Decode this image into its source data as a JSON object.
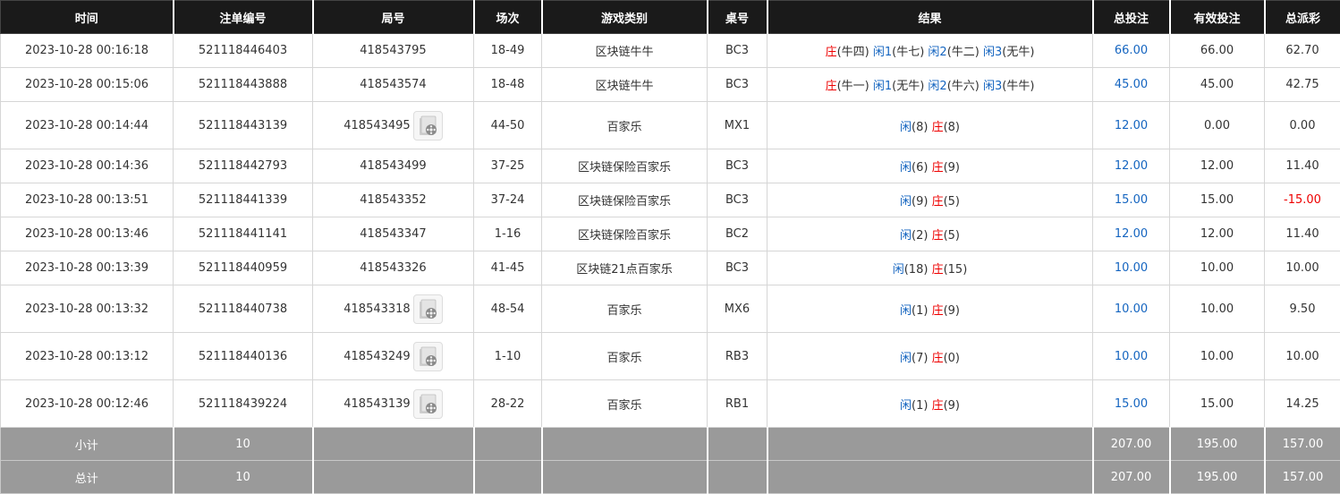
{
  "headers": [
    "时间",
    "注单编号",
    "局号",
    "场次",
    "游戏类别",
    "桌号",
    "结果",
    "总投注",
    "有效投注",
    "总派彩"
  ],
  "rows": [
    {
      "time": "2023-10-28 00:16:18",
      "order": "521118446403",
      "round": "418543795",
      "video": false,
      "game_no": "18-49",
      "type": "区块链牛牛",
      "table": "BC3",
      "result": [
        {
          "t": "庄",
          "c": "red"
        },
        {
          "t": "(牛四) ",
          "c": ""
        },
        {
          "t": "闲1",
          "c": "blue"
        },
        {
          "t": "(牛七) ",
          "c": ""
        },
        {
          "t": "闲2",
          "c": "blue"
        },
        {
          "t": "(牛二) ",
          "c": ""
        },
        {
          "t": "闲3",
          "c": "blue"
        },
        {
          "t": "(无牛)",
          "c": ""
        }
      ],
      "total": "66.00",
      "valid": "66.00",
      "payout": "62.70",
      "payout_neg": false
    },
    {
      "time": "2023-10-28 00:15:06",
      "order": "521118443888",
      "round": "418543574",
      "video": false,
      "game_no": "18-48",
      "type": "区块链牛牛",
      "table": "BC3",
      "result": [
        {
          "t": "庄",
          "c": "red"
        },
        {
          "t": "(牛一) ",
          "c": ""
        },
        {
          "t": "闲1",
          "c": "blue"
        },
        {
          "t": "(无牛) ",
          "c": ""
        },
        {
          "t": "闲2",
          "c": "blue"
        },
        {
          "t": "(牛六) ",
          "c": ""
        },
        {
          "t": "闲3",
          "c": "blue"
        },
        {
          "t": "(牛牛)",
          "c": ""
        }
      ],
      "total": "45.00",
      "valid": "45.00",
      "payout": "42.75",
      "payout_neg": false
    },
    {
      "time": "2023-10-28 00:14:44",
      "order": "521118443139",
      "round": "418543495",
      "video": true,
      "game_no": "44-50",
      "type": "百家乐",
      "table": "MX1",
      "result": [
        {
          "t": "闲",
          "c": "blue"
        },
        {
          "t": "(8) ",
          "c": ""
        },
        {
          "t": "庄",
          "c": "red"
        },
        {
          "t": "(8)",
          "c": ""
        }
      ],
      "total": "12.00",
      "valid": "0.00",
      "payout": "0.00",
      "payout_neg": false
    },
    {
      "time": "2023-10-28 00:14:36",
      "order": "521118442793",
      "round": "418543499",
      "video": false,
      "game_no": "37-25",
      "type": "区块链保险百家乐",
      "table": "BC3",
      "result": [
        {
          "t": "闲",
          "c": "blue"
        },
        {
          "t": "(6) ",
          "c": ""
        },
        {
          "t": "庄",
          "c": "red"
        },
        {
          "t": "(9)",
          "c": ""
        }
      ],
      "total": "12.00",
      "valid": "12.00",
      "payout": "11.40",
      "payout_neg": false
    },
    {
      "time": "2023-10-28 00:13:51",
      "order": "521118441339",
      "round": "418543352",
      "video": false,
      "game_no": "37-24",
      "type": "区块链保险百家乐",
      "table": "BC3",
      "result": [
        {
          "t": "闲",
          "c": "blue"
        },
        {
          "t": "(9) ",
          "c": ""
        },
        {
          "t": "庄",
          "c": "red"
        },
        {
          "t": "(5)",
          "c": ""
        }
      ],
      "total": "15.00",
      "valid": "15.00",
      "payout": "-15.00",
      "payout_neg": true
    },
    {
      "time": "2023-10-28 00:13:46",
      "order": "521118441141",
      "round": "418543347",
      "video": false,
      "game_no": "1-16",
      "type": "区块链保险百家乐",
      "table": "BC2",
      "result": [
        {
          "t": "闲",
          "c": "blue"
        },
        {
          "t": "(2) ",
          "c": ""
        },
        {
          "t": "庄",
          "c": "red"
        },
        {
          "t": "(5)",
          "c": ""
        }
      ],
      "total": "12.00",
      "valid": "12.00",
      "payout": "11.40",
      "payout_neg": false
    },
    {
      "time": "2023-10-28 00:13:39",
      "order": "521118440959",
      "round": "418543326",
      "video": false,
      "game_no": "41-45",
      "type": "区块链21点百家乐",
      "table": "BC3",
      "result": [
        {
          "t": "闲",
          "c": "blue"
        },
        {
          "t": "(18) ",
          "c": ""
        },
        {
          "t": "庄",
          "c": "red"
        },
        {
          "t": "(15)",
          "c": ""
        }
      ],
      "total": "10.00",
      "valid": "10.00",
      "payout": "10.00",
      "payout_neg": false
    },
    {
      "time": "2023-10-28 00:13:32",
      "order": "521118440738",
      "round": "418543318",
      "video": true,
      "game_no": "48-54",
      "type": "百家乐",
      "table": "MX6",
      "result": [
        {
          "t": "闲",
          "c": "blue"
        },
        {
          "t": "(1) ",
          "c": ""
        },
        {
          "t": "庄",
          "c": "red"
        },
        {
          "t": "(9)",
          "c": ""
        }
      ],
      "total": "10.00",
      "valid": "10.00",
      "payout": "9.50",
      "payout_neg": false
    },
    {
      "time": "2023-10-28 00:13:12",
      "order": "521118440136",
      "round": "418543249",
      "video": true,
      "game_no": "1-10",
      "type": "百家乐",
      "table": "RB3",
      "result": [
        {
          "t": "闲",
          "c": "blue"
        },
        {
          "t": "(7) ",
          "c": ""
        },
        {
          "t": "庄",
          "c": "red"
        },
        {
          "t": "(0)",
          "c": ""
        }
      ],
      "total": "10.00",
      "valid": "10.00",
      "payout": "10.00",
      "payout_neg": false
    },
    {
      "time": "2023-10-28 00:12:46",
      "order": "521118439224",
      "round": "418543139",
      "video": true,
      "game_no": "28-22",
      "type": "百家乐",
      "table": "RB1",
      "result": [
        {
          "t": "闲",
          "c": "blue"
        },
        {
          "t": "(1) ",
          "c": ""
        },
        {
          "t": "庄",
          "c": "red"
        },
        {
          "t": "(9)",
          "c": ""
        }
      ],
      "total": "15.00",
      "valid": "15.00",
      "payout": "14.25",
      "payout_neg": false
    }
  ],
  "subtotal": {
    "label": "小计",
    "count": "10",
    "total": "207.00",
    "valid": "195.00",
    "payout": "157.00"
  },
  "grandtotal": {
    "label": "总计",
    "count": "10",
    "total": "207.00",
    "valid": "195.00",
    "payout": "157.00"
  },
  "colors": {
    "header_bg": "#1a1a1a",
    "footer_bg": "#9a9a9a",
    "blue": "#1565c0",
    "red": "#e00000"
  },
  "icons": {
    "video": "video-replay-icon"
  }
}
